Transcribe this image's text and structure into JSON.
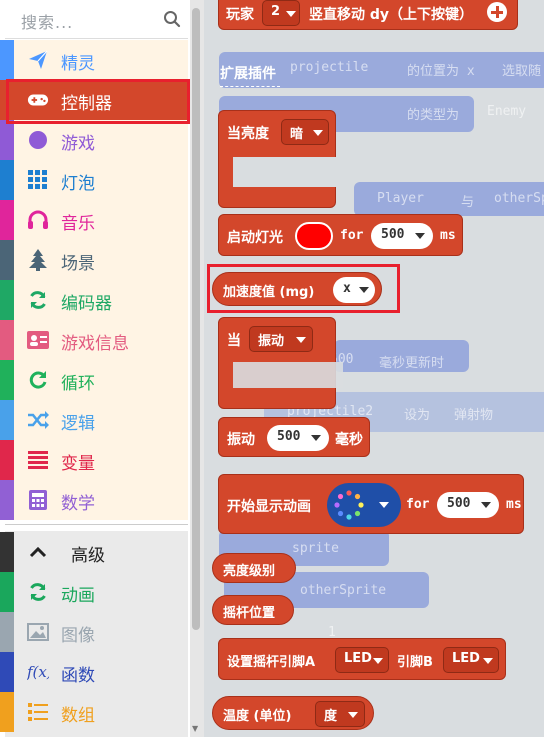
{
  "search": {
    "placeholder": "搜索..."
  },
  "categories": [
    {
      "label": "精灵",
      "color": "#4c97ff",
      "icon": "paper-plane-icon"
    },
    {
      "label": "控制器",
      "color": "#d3472b",
      "icon": "gamepad-icon"
    },
    {
      "label": "游戏",
      "color": "#8f5ad6",
      "icon": "circle-icon"
    },
    {
      "label": "灯泡",
      "color": "#1e7fd0",
      "icon": "grid-icon"
    },
    {
      "label": "音乐",
      "color": "#e0259b",
      "icon": "headphones-icon"
    },
    {
      "label": "场景",
      "color": "#4b6577",
      "icon": "tree-icon"
    },
    {
      "label": "编码器",
      "color": "#1fa865",
      "icon": "refresh-icon"
    },
    {
      "label": "游戏信息",
      "color": "#e35b80",
      "icon": "id-card-icon"
    },
    {
      "label": "循环",
      "color": "#20b15b",
      "icon": "loop-icon"
    },
    {
      "label": "逻辑",
      "color": "#49a1ea",
      "icon": "shuffle-icon"
    },
    {
      "label": "变量",
      "color": "#e0274b",
      "icon": "list-icon"
    },
    {
      "label": "数学",
      "color": "#9160d4",
      "icon": "calculator-icon"
    }
  ],
  "advanced": {
    "label": "高级",
    "items": [
      {
        "label": "动画",
        "color": "#1aa75c",
        "icon": "refresh-icon"
      },
      {
        "label": "图像",
        "color": "#9aa6b0",
        "icon": "image-icon"
      },
      {
        "label": "函数",
        "color": "#2f4ab7",
        "icon": "function-icon"
      },
      {
        "label": "数组",
        "color": "#f0a01e",
        "icon": "array-list-icon"
      }
    ]
  },
  "flyout": {
    "section_label": "扩展插件",
    "top_block": {
      "text": "玩家",
      "player": "2",
      "action": "竖直移动 dy（上下按键）"
    },
    "brightness_block": {
      "text": "当亮度",
      "value": "暗"
    },
    "light_block": {
      "text": "启动灯光",
      "for": "for",
      "ms_value": "500",
      "ms": "ms",
      "color": "#ff0000"
    },
    "accel_block": {
      "text": "加速度值 (mg)",
      "axis": "x"
    },
    "vibrate_event": {
      "text": "当",
      "value": "振动"
    },
    "vibrate_block": {
      "text": "振动",
      "value": "500",
      "unit": "毫秒"
    },
    "animation_block": {
      "text": "开始显示动画",
      "for": "for",
      "ms_value": "500",
      "ms": "ms"
    },
    "brightness_level": {
      "text": "亮度级别"
    },
    "joystick_pos": {
      "text": "摇杆位置"
    },
    "joystick_pins": {
      "text": "设置摇杆引脚A",
      "pinA": "LED",
      "pinB_label": "引脚B",
      "pinB": "LED"
    },
    "temperature": {
      "text": "温度 (单位)",
      "unit": "度"
    },
    "ghosts": {
      "g1": "projectile",
      "g2": "的位置为 x",
      "g3": "选取随",
      "g4": "的类型为",
      "g5": "Enemy",
      "g6": "Player",
      "g7": "与",
      "g8": "otherSp",
      "g9": "500",
      "g10": "毫秒更新时",
      "g11": "projectile2",
      "g12": "设为",
      "g13": "弹射物",
      "g14": "sprite",
      "g15": "otherSprite",
      "g16": "1"
    }
  }
}
